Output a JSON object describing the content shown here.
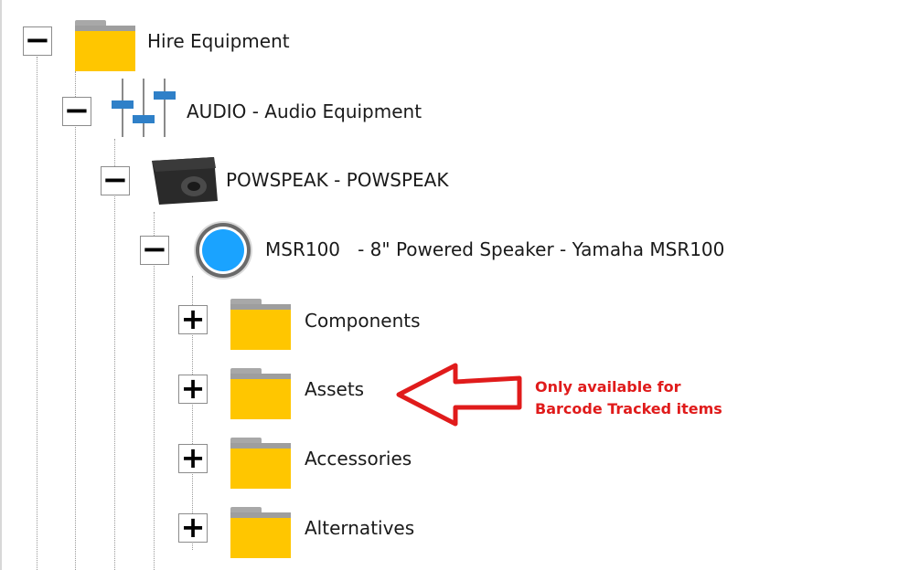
{
  "tree": {
    "root": {
      "label": "Hire Equipment",
      "toggle": "−",
      "icon": "folder-icon"
    },
    "audio": {
      "label": "AUDIO - Audio Equipment",
      "toggle": "−",
      "icon": "mixer-sliders-icon"
    },
    "powspeak": {
      "label": "POWSPEAK - POWSPEAK",
      "toggle": "−",
      "icon": "speaker-icon"
    },
    "product": {
      "label": "MSR100   - 8\" Powered Speaker - Yamaha MSR100",
      "toggle": "−",
      "icon": "blue-circle-icon"
    },
    "children": [
      {
        "label": "Components",
        "toggle": "+",
        "icon": "folder-icon"
      },
      {
        "label": "Assets",
        "toggle": "+",
        "icon": "folder-icon"
      },
      {
        "label": "Accessories",
        "toggle": "+",
        "icon": "folder-icon"
      },
      {
        "label": "Alternatives",
        "toggle": "+",
        "icon": "folder-icon"
      }
    ]
  },
  "annotation": {
    "line1": "Only available for",
    "line2": "Barcode Tracked items",
    "color": "#e01b1b",
    "arrow_icon": "left-arrow-icon"
  },
  "colors": {
    "folder_body": "#ffc600",
    "folder_tab": "#9e9e9e",
    "slider_blue": "#2f80c8",
    "circle_blue": "#1aa3ff",
    "speaker_dark": "#222222"
  }
}
